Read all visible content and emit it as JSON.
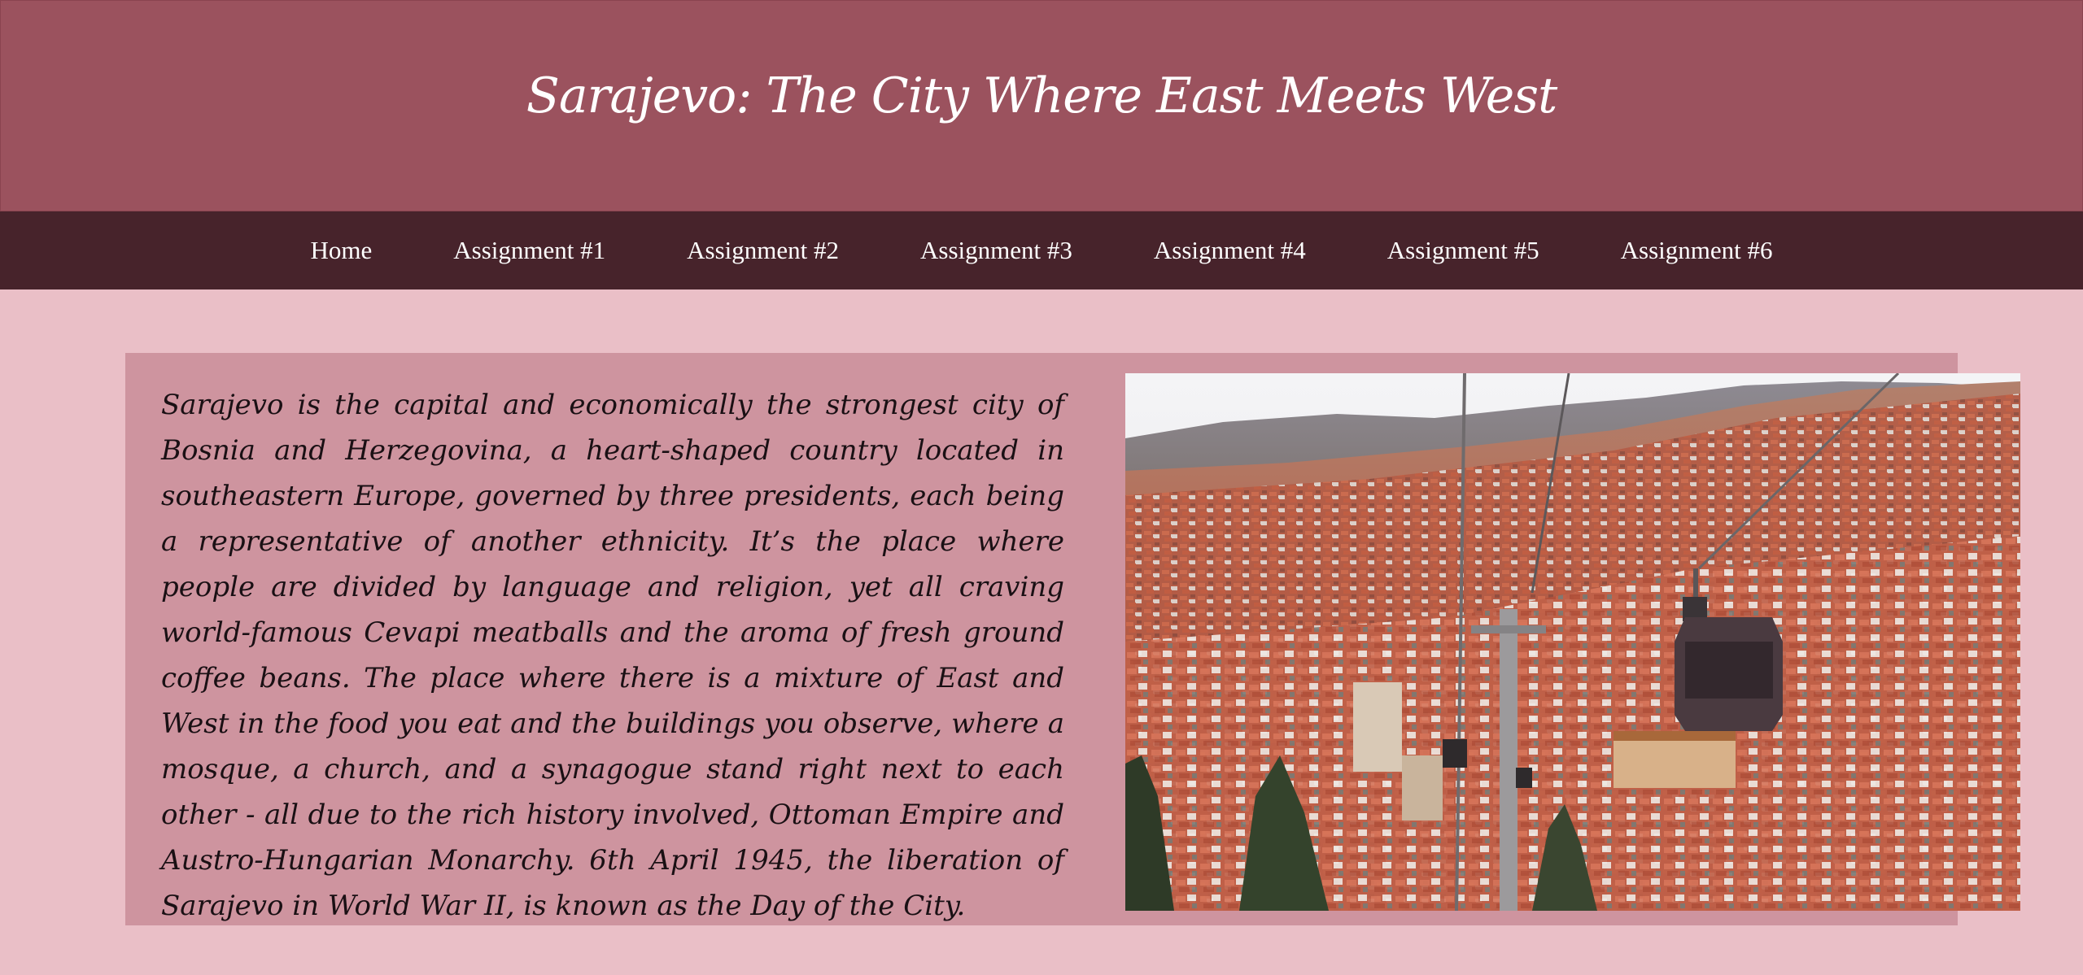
{
  "header": {
    "title": "Sarajevo: The City Where East Meets West"
  },
  "nav": {
    "items": [
      {
        "label": "Home"
      },
      {
        "label": "Assignment #1"
      },
      {
        "label": "Assignment #2"
      },
      {
        "label": "Assignment #3"
      },
      {
        "label": "Assignment #4"
      },
      {
        "label": "Assignment #5"
      },
      {
        "label": "Assignment #6"
      }
    ]
  },
  "main": {
    "paragraph": "Sarajevo is the capital and economically the strongest city of Bosnia and Herzegovina, a heart-shaped country located in southeastern Europe, governed by three presidents, each being a representative of another ethnicity. It’s the place where people are divided by language and religion, yet all craving world-famous Cevapi meatballs and the aroma of fresh ground coffee beans. The place where there is a mixture of East and West in the food you eat and the buildings you observe, where a mosque, a church, and a synagogue stand right next to each other - all due to the rich history involved, Ottoman Empire and Austro-Hungarian Monarchy. 6th April 1945, the liberation of Sarajevo in World War II, is known as the Day of the City."
  },
  "colors": {
    "page_background": "#eabfc7",
    "header_background": "#9b525e",
    "nav_background": "#47232b",
    "content_background": "#ce949f"
  }
}
